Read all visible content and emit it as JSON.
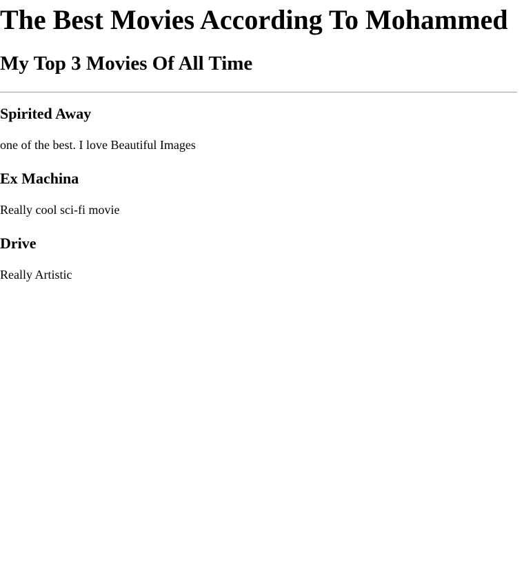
{
  "page": {
    "title": "The Best Movies According To Mohammed",
    "subtitle": "My Top 3 Movies Of All Time"
  },
  "movies": [
    {
      "title": "Spirited Away",
      "description": "one of the best. I love Beautiful Images"
    },
    {
      "title": "Ex Machina",
      "description": "Really cool sci-fi movie"
    },
    {
      "title": "Drive",
      "description": "Really Artistic"
    }
  ]
}
